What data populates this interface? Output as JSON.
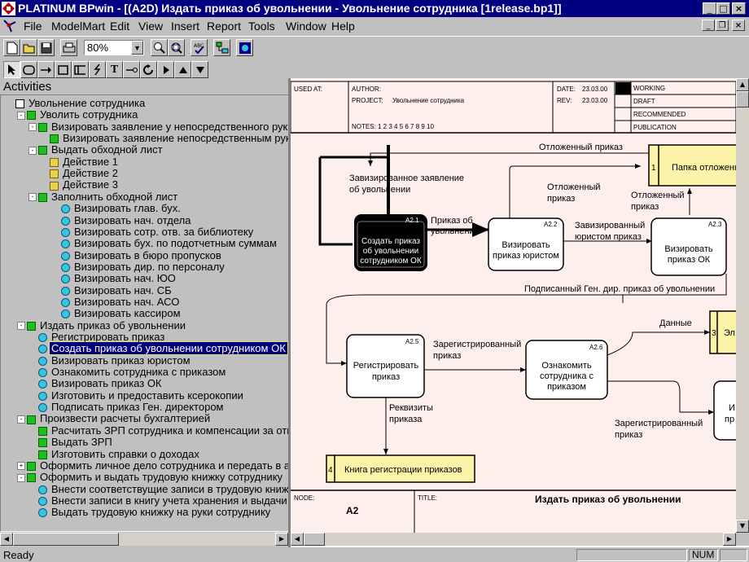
{
  "window": {
    "title": "PLATINUM BPwin - [(A2D) Издать приказ об увольнении - Увольнение сотрудника  [1release.bp1]]"
  },
  "menu": [
    "File",
    "ModelMart",
    "Edit",
    "View",
    "Insert",
    "Report",
    "Tools",
    "Window",
    "Help"
  ],
  "toolbar": {
    "zoom": "80%"
  },
  "toolbar2": {
    "text_tool": "T"
  },
  "activities": {
    "title": "Activities",
    "items": [
      {
        "label": "Увольнение сотрудника",
        "level": 0,
        "icon": "root",
        "toggle": ""
      },
      {
        "label": "Уволить сотрудника",
        "level": 1,
        "icon": "green",
        "toggle": "-"
      },
      {
        "label": "Визировать заявление у непосредственного руководителя",
        "level": 2,
        "icon": "green",
        "toggle": "-"
      },
      {
        "label": "Визировать заявление непосредственным руководителем",
        "level": 3,
        "icon": "green",
        "toggle": ""
      },
      {
        "label": "Выдать обходной лист",
        "level": 2,
        "icon": "green",
        "toggle": "-"
      },
      {
        "label": "Действие 1",
        "level": 3,
        "icon": "yellow",
        "toggle": ""
      },
      {
        "label": "Действие 2",
        "level": 3,
        "icon": "yellow",
        "toggle": ""
      },
      {
        "label": "Действие 3",
        "level": 3,
        "icon": "yellow",
        "toggle": ""
      },
      {
        "label": "Заполнить обходной лист",
        "level": 2,
        "icon": "green",
        "toggle": "-"
      },
      {
        "label": "Визировать глав. бух.",
        "level": 4,
        "icon": "cyan",
        "toggle": ""
      },
      {
        "label": "Визировать нач. отдела",
        "level": 4,
        "icon": "cyan",
        "toggle": ""
      },
      {
        "label": "Визировать сотр. отв. за библиотеку",
        "level": 4,
        "icon": "cyan",
        "toggle": ""
      },
      {
        "label": "Визировать бух. по подотчетным суммам",
        "level": 4,
        "icon": "cyan",
        "toggle": ""
      },
      {
        "label": "Визировать в бюро пропусков",
        "level": 4,
        "icon": "cyan",
        "toggle": ""
      },
      {
        "label": "Визировать дир. по персоналу",
        "level": 4,
        "icon": "cyan",
        "toggle": ""
      },
      {
        "label": "Визировать нач. ЮО",
        "level": 4,
        "icon": "cyan",
        "toggle": ""
      },
      {
        "label": "Визировать нач. СБ",
        "level": 4,
        "icon": "cyan",
        "toggle": ""
      },
      {
        "label": "Визировать нач. АСО",
        "level": 4,
        "icon": "cyan",
        "toggle": ""
      },
      {
        "label": "Визировать кассиром",
        "level": 4,
        "icon": "cyan",
        "toggle": ""
      },
      {
        "label": "Издать приказ об увольнении",
        "level": 1,
        "icon": "green",
        "toggle": "-"
      },
      {
        "label": "Регистрировать приказ",
        "level": 2,
        "icon": "cyan",
        "toggle": ""
      },
      {
        "label": "Создать приказ об увольнении сотрудником ОК",
        "level": 2,
        "icon": "cyan",
        "toggle": "",
        "selected": true
      },
      {
        "label": "Визировать приказ юристом",
        "level": 2,
        "icon": "cyan",
        "toggle": ""
      },
      {
        "label": "Ознакомить сотрудника с приказом",
        "level": 2,
        "icon": "cyan",
        "toggle": ""
      },
      {
        "label": "Визировать приказ ОК",
        "level": 2,
        "icon": "cyan",
        "toggle": ""
      },
      {
        "label": "Изготовить и предоставить ксерокопии",
        "level": 2,
        "icon": "cyan",
        "toggle": ""
      },
      {
        "label": "Подписать приказ Ген. директором",
        "level": 2,
        "icon": "cyan",
        "toggle": ""
      },
      {
        "label": "Произвести расчеты бухгалтерией",
        "level": 1,
        "icon": "green",
        "toggle": "-"
      },
      {
        "label": "Расчитать ЗРП сотрудника и компенсации за отпуск",
        "level": 2,
        "icon": "green",
        "toggle": ""
      },
      {
        "label": "Выдать ЗРП",
        "level": 2,
        "icon": "green",
        "toggle": ""
      },
      {
        "label": "Изготовить справки о доходах",
        "level": 2,
        "icon": "green",
        "toggle": ""
      },
      {
        "label": "Оформить личное дело сотрудника и передать в архив",
        "level": 1,
        "icon": "green",
        "toggle": "+"
      },
      {
        "label": "Оформить и выдать трудовую книжку сотруднику",
        "level": 1,
        "icon": "green",
        "toggle": "-"
      },
      {
        "label": "Внести соответствущие записи в трудовую книжку",
        "level": 2,
        "icon": "cyan",
        "toggle": ""
      },
      {
        "label": "Внести записи в книгу учета хранения и выдачи",
        "level": 2,
        "icon": "cyan",
        "toggle": ""
      },
      {
        "label": "Выдать трудовую книжку на руки сотруднику",
        "level": 2,
        "icon": "cyan",
        "toggle": ""
      }
    ]
  },
  "header": {
    "used_at": "USED AT:",
    "author": "AUTHOR:",
    "project_label": "PROJECT:",
    "project": "Увольнение сотрудника",
    "notes": "NOTES:  1  2  3  4  5  6  7  8  9  10",
    "date_label": "DATE:",
    "date": "23.03.00",
    "rev_label": "REV:",
    "rev": "23.03.00",
    "status": [
      "WORKING",
      "DRAFT",
      "RECOMMENDED",
      "PUBLICATION"
    ]
  },
  "diagram": {
    "boxes": [
      {
        "id": "A2.1",
        "line1": "Создать приказ",
        "line2": "об увольнении",
        "line3": "сотрудником ОК"
      },
      {
        "id": "A2.2",
        "line1": "Визировать",
        "line2": "приказ юристом"
      },
      {
        "id": "A2.3",
        "line1": "Визировать",
        "line2": "приказ ОК"
      },
      {
        "id": "A2.5",
        "line1": "Регистрировать",
        "line2": "приказ"
      },
      {
        "id": "A2.6",
        "line1": "Ознакомить",
        "line2": "сотрудника с",
        "line3": "приказом"
      }
    ],
    "partial_box_1": "И",
    "partial_box_2": "пр",
    "partial_box_3": "",
    "stores": [
      {
        "num": "1",
        "label": "Папка отложенных"
      },
      {
        "num": "3",
        "label": "Эл"
      },
      {
        "num": "4",
        "label": "Книга регистрации приказов"
      }
    ],
    "arrows": {
      "a1": "Отложенный приказ",
      "a2_l1": "Завизированное заявление",
      "a2_l2": "об увольнении",
      "a3_l1": "Отложенный",
      "a3_l2": "приказ",
      "a4_l1": "Приказ об",
      "a4_l2": "увольнении",
      "a5_l1": "Завизированный",
      "a5_l2": "юристом приказ",
      "a6_l1": "Отложенный",
      "a6_l2": "приказ",
      "a7": "Подписанный Ген. дир. приказ об увольнении",
      "a8": "Данные",
      "a9_l1": "Зарегистрированный",
      "a9_l2": "приказ",
      "a10_l1": "Реквизиты",
      "a10_l2": "приказа",
      "a11_l1": "Зарегистрированный",
      "a11_l2": "приказ"
    }
  },
  "footer": {
    "node_label": "NODE:",
    "node": "A2",
    "title_label": "TITLE:",
    "title": "Издать приказ об увольнении"
  },
  "status": {
    "text": "Ready",
    "num": "NUM"
  }
}
